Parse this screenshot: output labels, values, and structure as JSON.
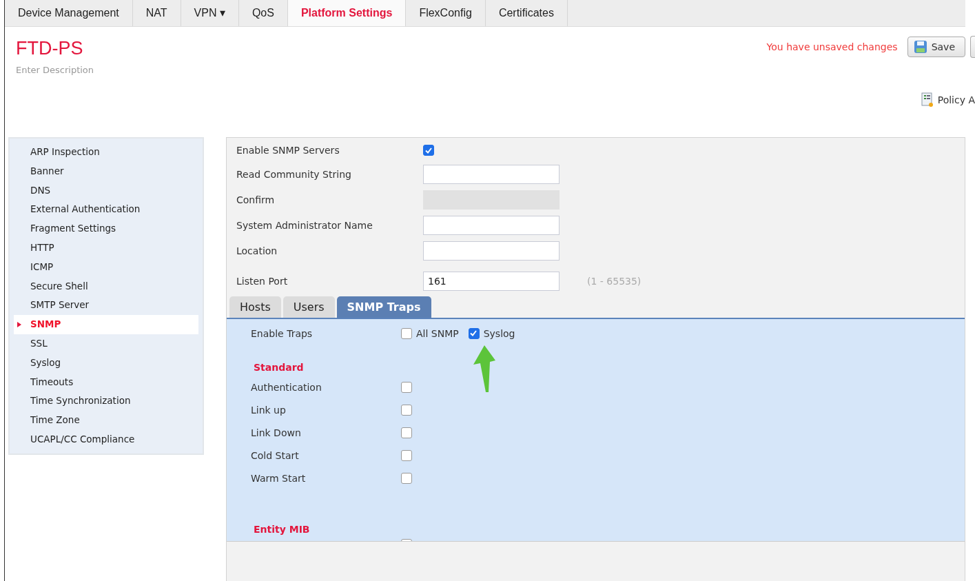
{
  "tabs": [
    {
      "label": "Device Management",
      "selected": false
    },
    {
      "label": "NAT",
      "selected": false
    },
    {
      "label": "VPN ▾",
      "selected": false
    },
    {
      "label": "QoS",
      "selected": false
    },
    {
      "label": "Platform Settings",
      "selected": true
    },
    {
      "label": "FlexConfig",
      "selected": false
    },
    {
      "label": "Certificates",
      "selected": false
    }
  ],
  "page": {
    "title": "FTD-PS",
    "description": "Enter Description",
    "unsaved_notice": "You have unsaved changes",
    "policy_link": "Policy A"
  },
  "buttons": [
    {
      "kind": "save",
      "label": "Save"
    },
    {
      "kind": "cut"
    }
  ],
  "sidebar": {
    "items": [
      {
        "label": "ARP Inspection",
        "selected": false
      },
      {
        "label": "Banner",
        "selected": false
      },
      {
        "label": "DNS",
        "selected": false
      },
      {
        "label": "External Authentication",
        "selected": false
      },
      {
        "label": "Fragment Settings",
        "selected": false
      },
      {
        "label": "HTTP",
        "selected": false
      },
      {
        "label": "ICMP",
        "selected": false
      },
      {
        "label": "Secure Shell",
        "selected": false
      },
      {
        "label": "SMTP Server",
        "selected": false
      },
      {
        "label": "SNMP",
        "selected": true
      },
      {
        "label": "SSL",
        "selected": false
      },
      {
        "label": "Syslog",
        "selected": false
      },
      {
        "label": "Timeouts",
        "selected": false
      },
      {
        "label": "Time Synchronization",
        "selected": false
      },
      {
        "label": "Time Zone",
        "selected": false
      },
      {
        "label": "UCAPL/CC Compliance",
        "selected": false
      }
    ]
  },
  "snmp": {
    "enable": {
      "label": "Enable SNMP Servers",
      "checked": true
    },
    "fields": [
      {
        "label": "Read Community String",
        "disabled": false
      },
      {
        "label": "Confirm",
        "disabled": true
      },
      {
        "label": "System Administrator Name",
        "disabled": false
      },
      {
        "label": "Location",
        "disabled": false
      },
      {
        "label": "Listen Port",
        "value": "161",
        "hint": "(1 - 65535)",
        "disabled": false
      }
    ],
    "subtabs": [
      {
        "label": "Hosts",
        "selected": false
      },
      {
        "label": "Users",
        "selected": false
      },
      {
        "label": "SNMP Traps",
        "selected": true
      }
    ],
    "traps": {
      "enable": {
        "label": "Enable Traps",
        "options": [
          {
            "label": "All SNMP",
            "checked": false
          },
          {
            "label": "Syslog",
            "checked": true
          }
        ]
      },
      "sections": [
        {
          "title": "Standard",
          "items": [
            {
              "label": "Authentication",
              "checked": false
            },
            {
              "label": "Link up",
              "checked": false
            },
            {
              "label": "Link Down",
              "checked": false
            },
            {
              "label": "Cold Start",
              "checked": false
            },
            {
              "label": "Warm Start",
              "checked": false
            }
          ]
        },
        {
          "title": "Entity MIB",
          "items": [
            {
              "checked": false
            }
          ]
        }
      ]
    }
  }
}
